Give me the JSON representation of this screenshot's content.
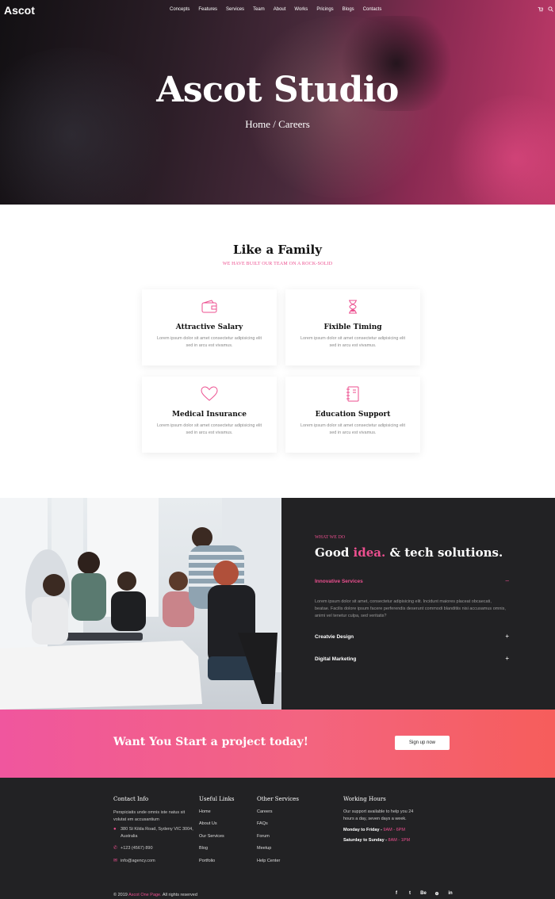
{
  "header": {
    "logo": "Ascot",
    "nav": [
      "Concepts",
      "Features",
      "Services",
      "Team",
      "About",
      "Works",
      "Pricings",
      "Blogs",
      "Contacts"
    ]
  },
  "hero": {
    "title": "Ascot Studio",
    "breadcrumb": "Home / Careers"
  },
  "family": {
    "title": "Like a Family",
    "subtitle": "WE HAVE BUILT OUR TEAM ON A ROCK-SOLID",
    "cards": [
      {
        "icon": "wallet-icon",
        "title": "Attractive Salary",
        "desc": "Lorem ipsum dolor sit amet consectetur adipisicing elit sed in arcu est vivamus."
      },
      {
        "icon": "hourglass-icon",
        "title": "Fixible Timing",
        "desc": "Lorem ipsum dolor sit amet consectetur adipisicing elit sed in arcu est vivamus."
      },
      {
        "icon": "heart-icon",
        "title": "Medical Insurance",
        "desc": "Lorem ipsum dolor sit amet consectetur adipisicing elit sed in arcu est vivamus."
      },
      {
        "icon": "notebook-icon",
        "title": "Education Support",
        "desc": "Lorem ipsum dolor sit amet consectetur adipisicing elit sed in arcu est vivamus."
      }
    ]
  },
  "whatwedo": {
    "eyebrow": "WHAT WE DO",
    "title_a": "Good",
    "title_b": "idea.",
    "title_c": "& tech solutions.",
    "accordion": [
      {
        "title": "Innovative Services",
        "toggle": "–",
        "body": "Lorem ipsum dolor sit amet, consectetur adipisicing elit. Incidunt maiores placeat obcaecati, beatae. Facilis dolore ipsum facere perferendis deserunt commodi blanditiis nisi accusamus omnis, animi vel tenetur culpa, sed veritatis?"
      },
      {
        "title": "Creatvie Design",
        "toggle": "+"
      },
      {
        "title": "Digital Marketing",
        "toggle": "+"
      }
    ]
  },
  "cta": {
    "text": "Want You Start a project today!",
    "button": "Sign up now"
  },
  "footer": {
    "contact_heading": "Contact Info",
    "contact_desc": "Perspiciatis unde omnis iste natus sit volutat em accusantium",
    "address": "380 St Kilda Road, Sydeny VIC 3004, Australia",
    "phone": "+123 (4567) 890",
    "email": "info@agency.com",
    "useful_heading": "Useful Links",
    "useful_links": [
      "Home",
      "About Us",
      "Our Services",
      "Blog",
      "Portfolio"
    ],
    "other_heading": "Other Services",
    "other_links": [
      "Careers",
      "FAQs",
      "Forum",
      "Meetup",
      "Help Center"
    ],
    "working_heading": "Working Hours",
    "working_desc": "Our support available to help you 24 hours a day, seven days a week.",
    "weekday_label": "Monday to Friday -",
    "weekday_time": "9AM - 6PM",
    "weekend_label": "Saturday to Sunday -",
    "weekend_time": "8AM - 1PM",
    "copyright_a": "© 2019",
    "copyright_b": "Ascot One Page.",
    "copyright_c": "All rights reserved",
    "social": [
      "f",
      "t",
      "Be",
      "⊕",
      "in"
    ]
  },
  "colors": {
    "accent": "#ec4f8f",
    "dark": "#222224",
    "cta_start": "#f0569e",
    "cta_end": "#f65d5b"
  }
}
